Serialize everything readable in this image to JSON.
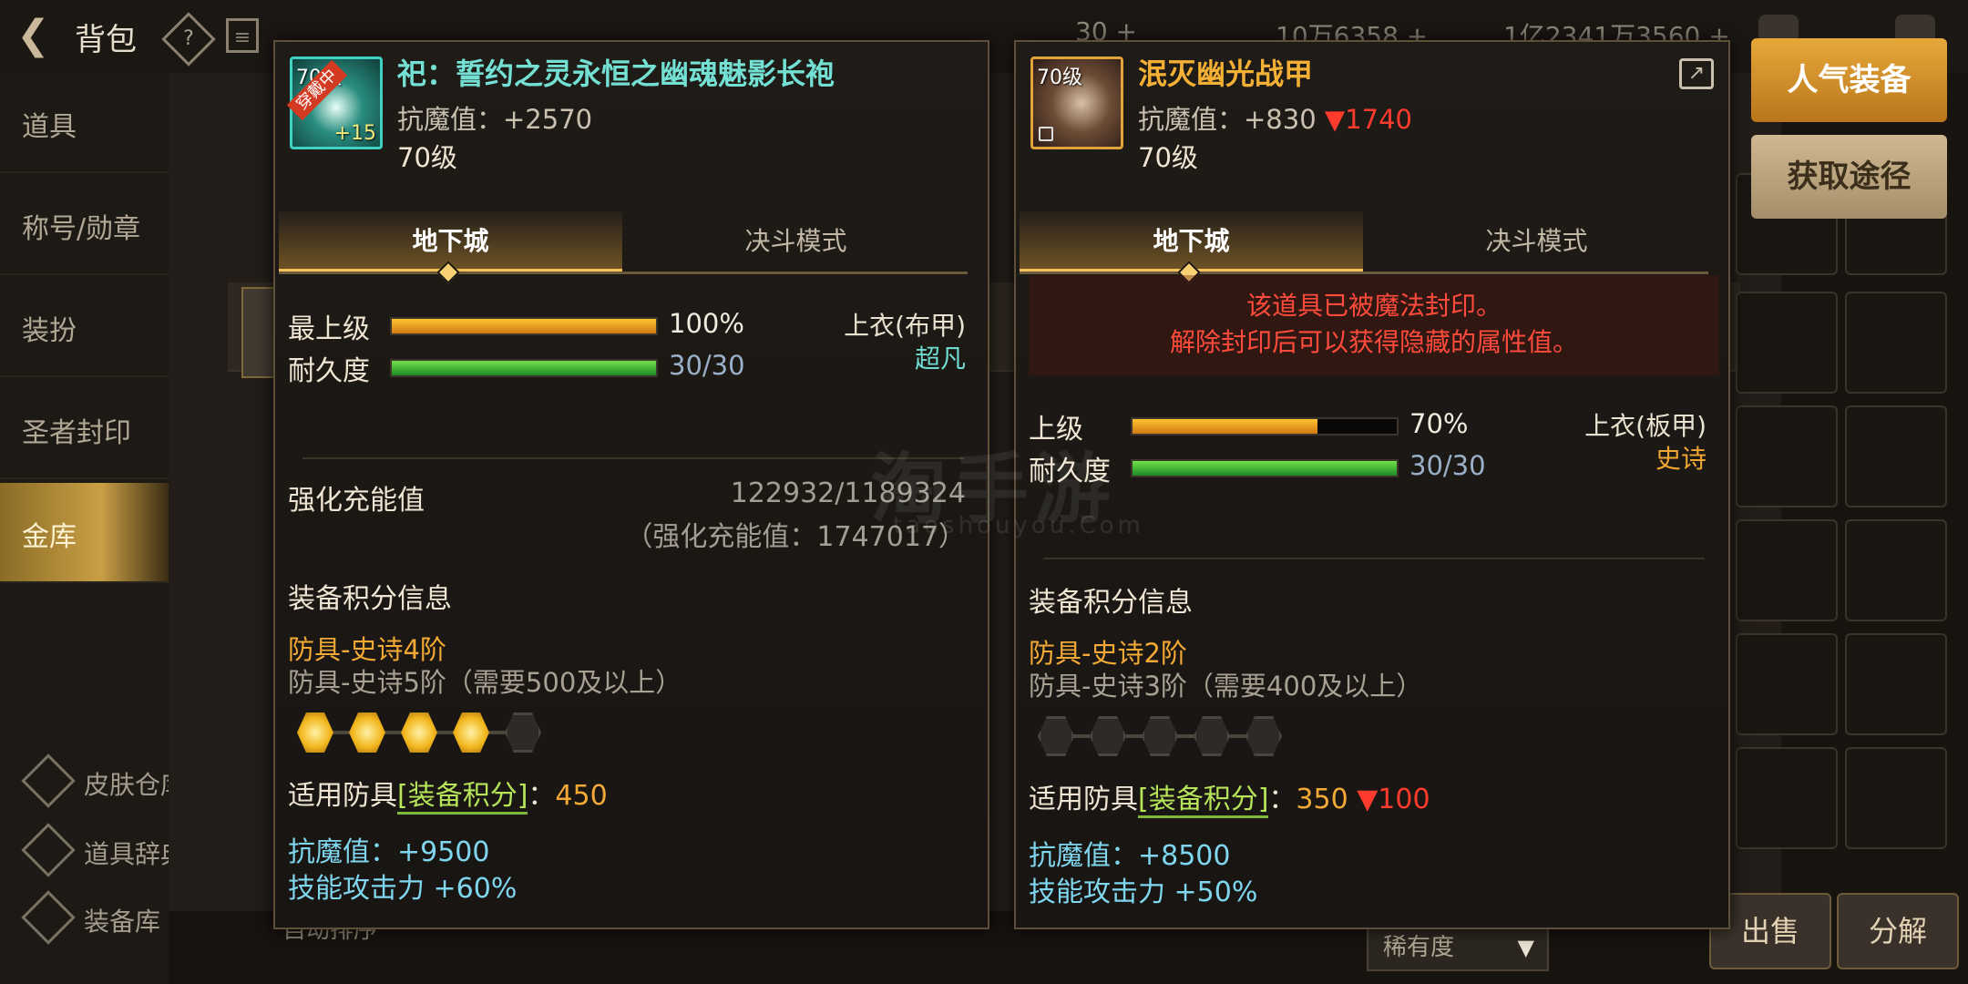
{
  "header": {
    "title": "背包",
    "currencies": [
      "30 +",
      "10万6358 +",
      "1亿2341万3560 +"
    ]
  },
  "sidebar": {
    "items": [
      "道具",
      "称号/勋章",
      "装扮",
      "圣者封印",
      "金库"
    ],
    "active_index": 4,
    "bottom_items": [
      "皮肤仓库",
      "道具辞典",
      "装备库"
    ]
  },
  "right_buttons": {
    "popular": "人气装备",
    "obtain": "获取途径"
  },
  "bottom_bar": {
    "sort": "自动排序",
    "rarity": "稀有度",
    "sell": "出售",
    "disassemble": "分解"
  },
  "watermark": {
    "cn": "淘手游",
    "en": "taoshouyou.Com"
  },
  "left_card": {
    "badge": "穿戴中",
    "thumb_level": "70级",
    "thumb_count": "+15",
    "name": "祀：誓约之灵永恒之幽魂魅影长袍",
    "magic_def": "抗魔值：+2570",
    "level": "70级",
    "tabs": [
      "地下城",
      "决斗模式"
    ],
    "grade_bar": {
      "label": "最上级",
      "percent": 100,
      "text": "100%"
    },
    "durability_bar": {
      "label": "耐久度",
      "percent": 100,
      "text": "30/30"
    },
    "slot": "上衣(布甲)",
    "grade": "超凡",
    "charge_label": "强化充能值",
    "charge_value": "122932/1189324",
    "charge_sub": "（强化充能值：1747017）",
    "score_title": "装备积分信息",
    "tier_current": "防具-史诗4阶",
    "tier_next": "防具-史诗5阶（需要500及以上）",
    "tier_filled": 4,
    "tier_total": 5,
    "score_prefix": "适用防具",
    "score_tag": "[装备积分]",
    "score_colon": "：",
    "score_value": "450",
    "bonus_magic": "抗魔值：+9500",
    "bonus_skill": "技能攻击力 +60%"
  },
  "right_card": {
    "thumb_level": "70级",
    "name": "泯灭幽光战甲",
    "magic_def": "抗魔值：+830",
    "magic_def_diff": "▼1740",
    "level": "70级",
    "tabs": [
      "地下城",
      "决斗模式"
    ],
    "seal_line1": "该道具已被魔法封印。",
    "seal_line2": "解除封印后可以获得隐藏的属性值。",
    "grade_bar": {
      "label": "上级",
      "percent": 70,
      "text": "70%"
    },
    "durability_bar": {
      "label": "耐久度",
      "percent": 100,
      "text": "30/30"
    },
    "slot": "上衣(板甲)",
    "grade": "史诗",
    "score_title": "装备积分信息",
    "tier_current": "防具-史诗2阶",
    "tier_next": "防具-史诗3阶（需要400及以上）",
    "tier_filled": 0,
    "tier_total": 5,
    "score_prefix": "适用防具",
    "score_tag": "[装备积分]",
    "score_colon": "：",
    "score_value": "350",
    "score_diff": "▼100",
    "bonus_magic": "抗魔值：+8500",
    "bonus_skill": "技能攻击力 +50%"
  }
}
